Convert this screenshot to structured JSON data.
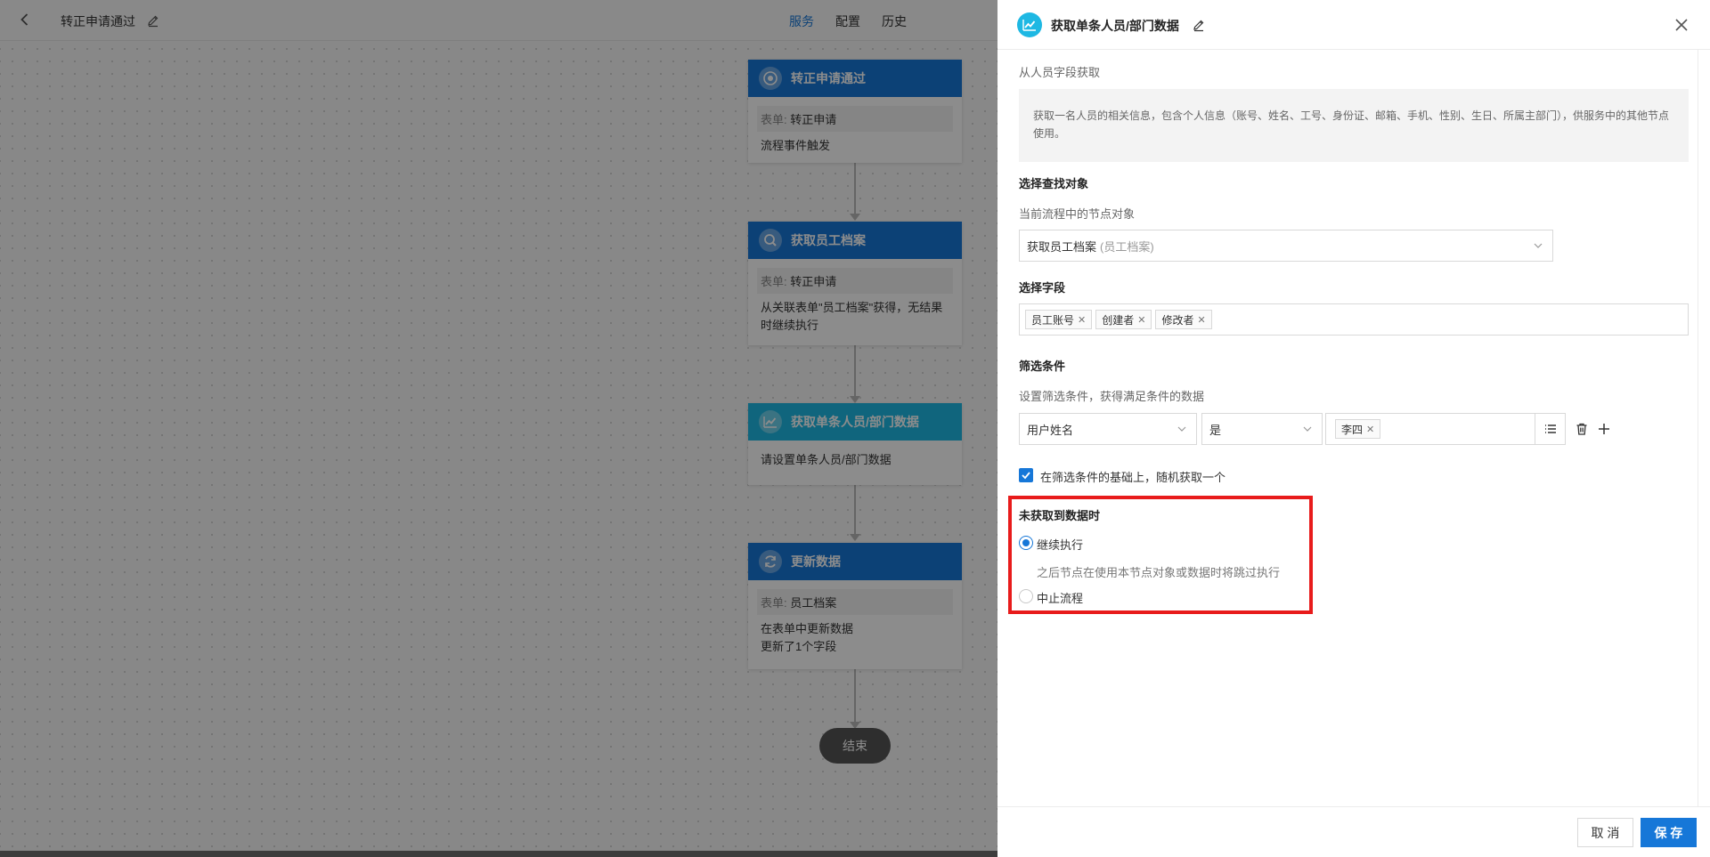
{
  "topbar": {
    "flow_title": "转正申请通过",
    "tabs": [
      {
        "label": "服务",
        "active": true
      },
      {
        "label": "配置",
        "active": false
      },
      {
        "label": "历史",
        "active": false
      }
    ]
  },
  "flow_nodes": [
    {
      "title": "转正申请通过",
      "icon": "target-icon",
      "form_label": "表单:",
      "form_value": "转正申请",
      "texts": [
        "流程事件触发"
      ]
    },
    {
      "title": "获取员工档案",
      "icon": "search-icon",
      "form_label": "表单:",
      "form_value": "转正申请",
      "texts": [
        "从关联表单\"员工档案\"获得，无结果",
        "时继续执行"
      ]
    },
    {
      "title": "获取单条人员/部门数据",
      "icon": "chart-icon",
      "texts": [
        "请设置单条人员/部门数据"
      ]
    },
    {
      "title": "更新数据",
      "icon": "refresh-icon",
      "form_label": "表单:",
      "form_value": "员工档案",
      "texts": [
        "在表单中更新数据",
        "更新了1个字段"
      ]
    }
  ],
  "end_node": "结束",
  "drawer": {
    "title": "获取单条人员/部门数据",
    "source_label": "从人员字段获取",
    "description": "获取一名人员的相关信息，包含个人信息（账号、姓名、工号、身份证、邮箱、手机、性别、生日、所属主部门），供服务中的其他节点使用。",
    "lookup": {
      "title": "选择查找对象",
      "sub": "当前流程中的节点对象",
      "selected": "获取员工档案",
      "selected_hint": "(员工档案)"
    },
    "fields": {
      "title": "选择字段",
      "tags": [
        "员工账号",
        "创建者",
        "修改者"
      ]
    },
    "filter": {
      "title": "筛选条件",
      "sub": "设置筛选条件，获得满足条件的数据",
      "field": "用户姓名",
      "operator": "是",
      "value_tag": "李四"
    },
    "random_pick": {
      "checked": true,
      "label": "在筛选条件的基础上，随机获取一个"
    },
    "no_data": {
      "title": "未获取到数据时",
      "options": [
        {
          "label": "继续执行",
          "selected": true,
          "hint": "之后节点在使用本节点对象或数据时将跳过执行"
        },
        {
          "label": "中止流程",
          "selected": false
        }
      ]
    },
    "footer": {
      "cancel": "取 消",
      "save": "保 存"
    }
  },
  "colors": {
    "primary": "#1677d8",
    "cyan": "#1eb8e3",
    "highlight": "#e81b1b"
  }
}
